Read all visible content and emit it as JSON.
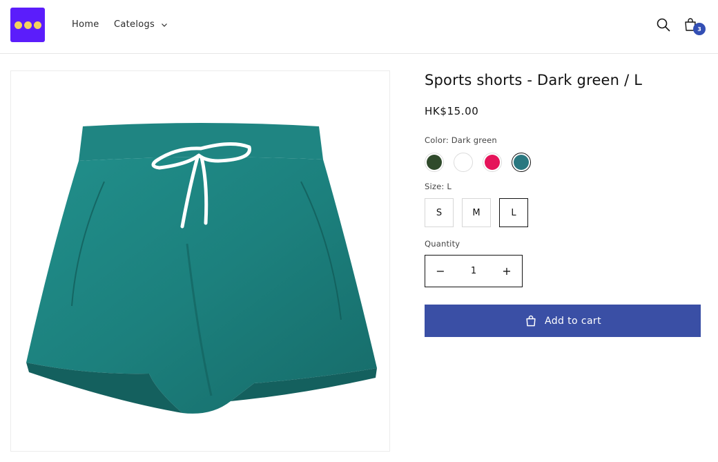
{
  "header": {
    "nav": [
      {
        "label": "Home"
      },
      {
        "label": "Catelogs"
      }
    ],
    "cart_count": "3"
  },
  "product": {
    "title": "Sports shorts - Dark green / L",
    "price": "HK$15.00",
    "color": {
      "label": "Color: Dark green",
      "swatches": [
        {
          "name": "Dark green",
          "hex": "#2f4a2b"
        },
        {
          "name": "White",
          "hex": "#ffffff"
        },
        {
          "name": "Pink",
          "hex": "#e5145a"
        },
        {
          "name": "Teal",
          "hex": "#2a7880"
        }
      ],
      "selected_index": 3
    },
    "size": {
      "label": "Size: L",
      "options": [
        "S",
        "M",
        "L"
      ],
      "selected": "L"
    },
    "quantity": {
      "label": "Quantity",
      "value": "1",
      "decrease": "−",
      "increase": "+"
    },
    "add_to_cart_label": "Add to cart"
  },
  "colors": {
    "logo_bg": "#5b1dfb",
    "logo_dots": "#f4d35e",
    "accent": "#3a4fa5",
    "badge": "#334fb4",
    "product_teal": "#1f8a86"
  },
  "icons": [
    "logo-icon",
    "chevron-down-icon",
    "search-icon",
    "cart-bag-icon",
    "minus-icon",
    "plus-icon",
    "shopping-bag-icon",
    "product-shorts-image"
  ]
}
